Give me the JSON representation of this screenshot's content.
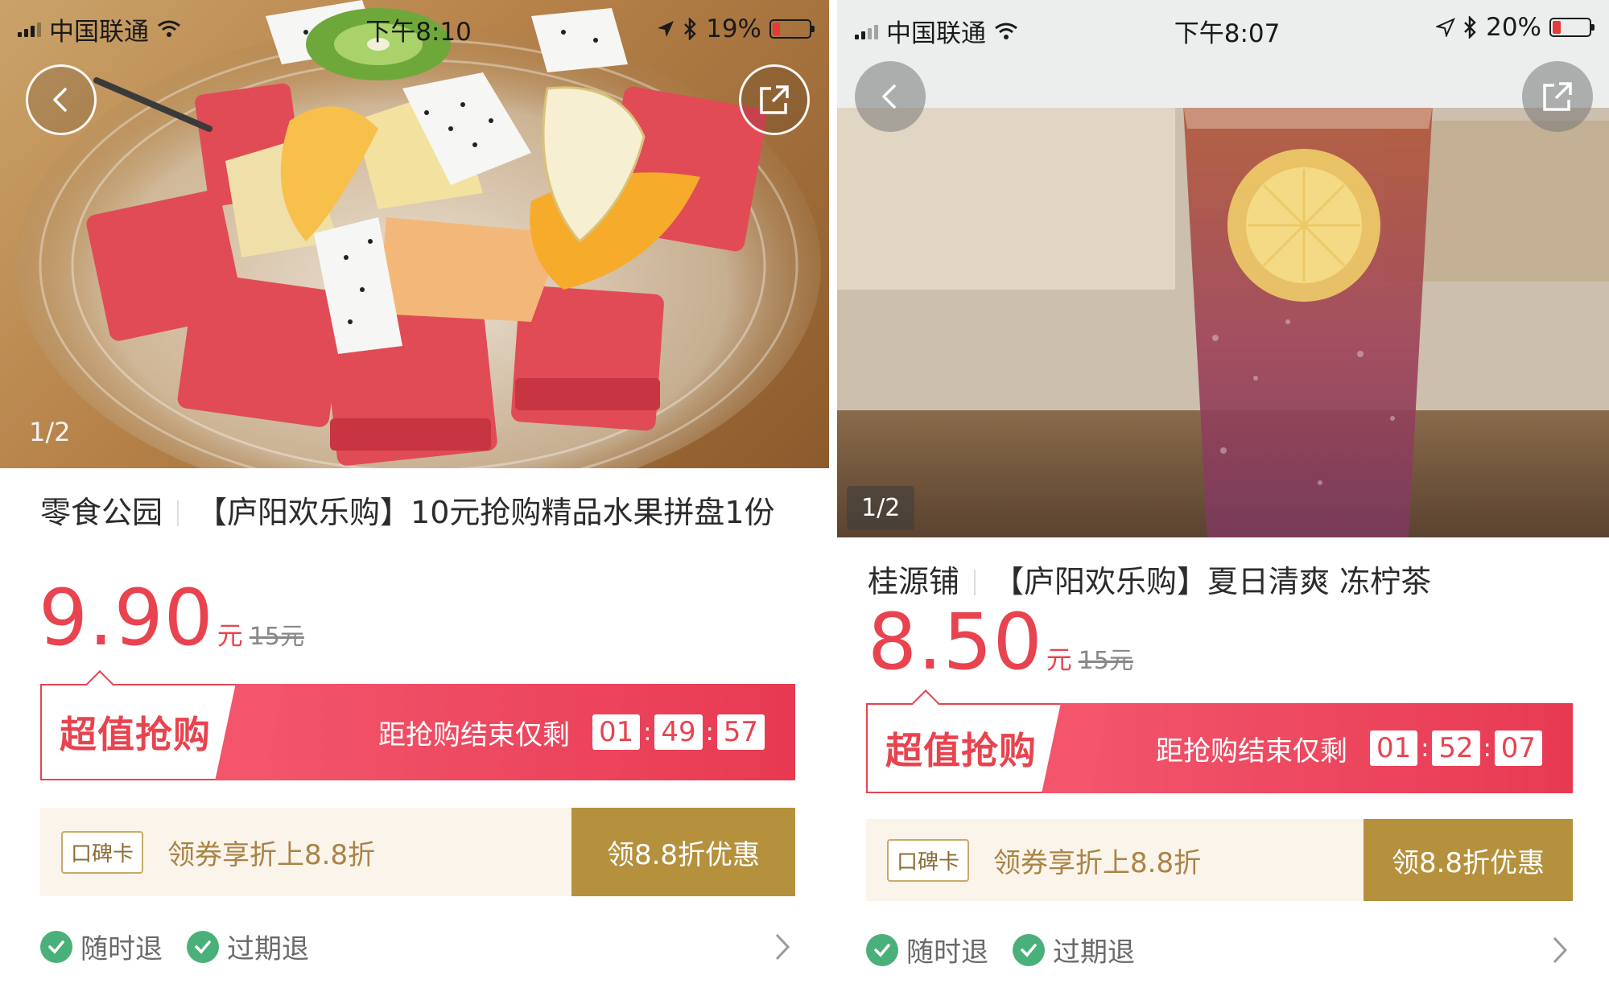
{
  "left": {
    "status": {
      "carrier": "中国联通",
      "time": "下午8:10",
      "battery": "19%",
      "battery_level": 19
    },
    "image_counter": "1/2",
    "title": {
      "shop": "零食公园",
      "product": "【庐阳欢乐购】10元抢购精品水果拼盘1份"
    },
    "price": {
      "current": "9.90",
      "unit": "元",
      "original": "15元"
    },
    "flash_sale": {
      "tag": "超值抢购",
      "label": "距抢购结束仅剩",
      "hours": "01",
      "minutes": "49",
      "seconds": "57"
    },
    "coupon": {
      "tag": "口碑卡",
      "text": "领券享折上8.8折",
      "button": "领8.8折优惠"
    },
    "guarantees": [
      "随时退",
      "过期退"
    ]
  },
  "right": {
    "status": {
      "carrier": "中国联通",
      "time": "下午8:07",
      "battery": "20%",
      "battery_level": 20
    },
    "image_counter": "1/2",
    "title": {
      "shop": "桂源铺",
      "product": "【庐阳欢乐购】夏日清爽 冻柠茶"
    },
    "price": {
      "current": "8.50",
      "unit": "元",
      "original": "15元"
    },
    "flash_sale": {
      "tag": "超值抢购",
      "label": "距抢购结束仅剩",
      "hours": "01",
      "minutes": "52",
      "seconds": "07"
    },
    "coupon": {
      "tag": "口碑卡",
      "text": "领券享折上8.8折",
      "button": "领8.8折优惠"
    },
    "guarantees": [
      "随时退",
      "过期退"
    ]
  },
  "icons": {
    "back": "back-arrow-icon",
    "share": "share-icon",
    "check": "check-circle-icon",
    "chevron": "chevron-right-icon",
    "wifi": "wifi-icon",
    "location": "location-arrow-icon",
    "bluetooth": "bluetooth-icon",
    "signal": "signal-bars-icon",
    "battery": "battery-icon"
  },
  "colors": {
    "price_red": "#e8434f",
    "coupon_gold": "#b5913e",
    "check_green": "#4ab07a"
  }
}
